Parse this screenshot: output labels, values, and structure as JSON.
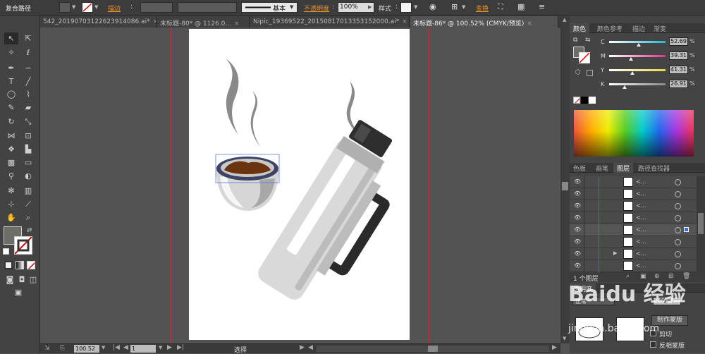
{
  "control_bar": {
    "selection_label": "复合路径",
    "stroke_label": "描边",
    "stroke_style": "基本",
    "opacity_label": "不透明度",
    "opacity_value": "100%",
    "style_label": "样式",
    "transform_label": "变换"
  },
  "tabs": [
    {
      "label": "542_20190703122623914086.ai*",
      "active": false
    },
    {
      "label": "未标题-80* @ 1126.0...",
      "active": false
    },
    {
      "label": "Nipic_19369522_20150817013353152000.ai*",
      "active": false
    },
    {
      "label": "未标题-86* @ 100.52% (CMYK/预览)",
      "active": true
    }
  ],
  "status": {
    "zoom": "100.52",
    "page": "1",
    "tool": "选择"
  },
  "color_panel": {
    "tabs": [
      "颜色",
      "颜色参考",
      "描边",
      "渐变"
    ],
    "channels": [
      {
        "name": "C",
        "value": "52.69",
        "fraction": 0.527,
        "color": "#20b8d8"
      },
      {
        "name": "M",
        "value": "39.31",
        "fraction": 0.393,
        "color": "#e0308c"
      },
      {
        "name": "Y",
        "value": "41.31",
        "fraction": 0.413,
        "color": "#e8d840"
      },
      {
        "name": "K",
        "value": "26.91",
        "fraction": 0.269,
        "color": "#888888"
      }
    ]
  },
  "layers_panel": {
    "tabs": [
      "色板",
      "画笔",
      "图层",
      "路径查找器"
    ],
    "layer_item_label": "<...",
    "rows": 8,
    "selected_row": 4,
    "footer": "1 个图层"
  },
  "transparency_panel": {
    "title": "透明度",
    "mode": "正常",
    "opacity": "100%",
    "make_mask": "制作蒙版",
    "clip": "剪切",
    "invert_mask": "反相蒙版"
  },
  "watermark": "Baidu 经验",
  "watermark_url": "jingyan.baidu.com"
}
